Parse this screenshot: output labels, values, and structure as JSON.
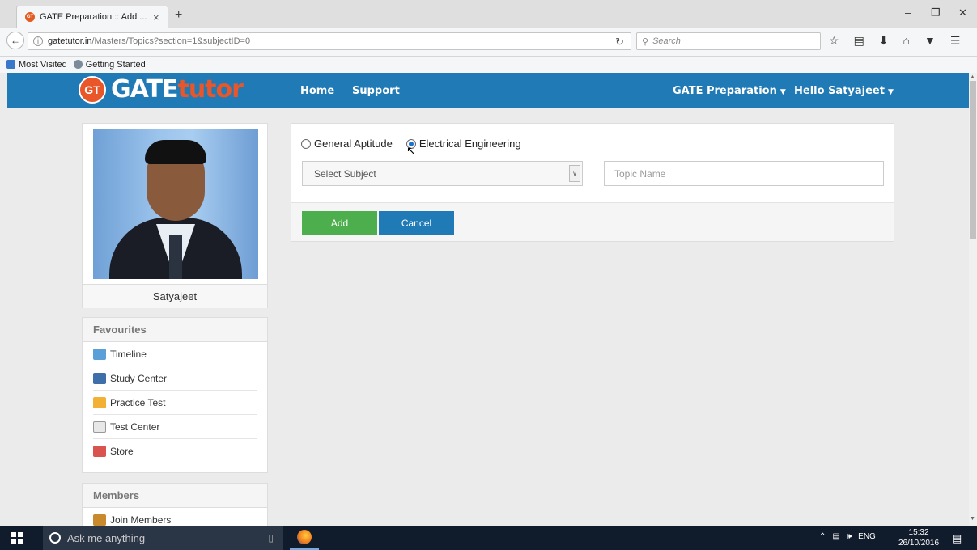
{
  "browser": {
    "tab_title": "GATE Preparation :: Add ...",
    "tab_close": "×",
    "new_tab": "+",
    "win_min": "–",
    "win_max": "❐",
    "win_close": "✕",
    "url_domain": "gatetutor.in",
    "url_path": "/Masters/Topics?section=1&subjectID=0",
    "search_placeholder": "Search",
    "bookmarks": [
      "Most Visited",
      "Getting Started"
    ]
  },
  "site": {
    "logo_badge": "GT",
    "logo_gate": "GATE",
    "logo_tutor": "tutor",
    "nav": {
      "home": "Home",
      "support": "Support",
      "prep": "GATE Preparation",
      "user": "Hello Satyajeet"
    }
  },
  "profile": {
    "name": "Satyajeet"
  },
  "favourites": {
    "heading": "Favourites",
    "items": [
      "Timeline",
      "Study Center",
      "Practice Test",
      "Test Center",
      "Store"
    ]
  },
  "members": {
    "heading": "Members",
    "items": [
      "Join Members"
    ]
  },
  "form": {
    "radio_general": "General Aptitude",
    "radio_electrical": "Electrical Engineering",
    "selected_radio": "Electrical Engineering",
    "subject_select": "Select Subject",
    "topic_placeholder": "Topic Name",
    "add_label": "Add",
    "cancel_label": "Cancel"
  },
  "taskbar": {
    "cortana_placeholder": "Ask me anything",
    "lang": "ENG",
    "time": "15:32",
    "date": "26/10/2016"
  },
  "colors": {
    "brand": "#1f7ab5",
    "accent": "#e8562a",
    "success": "#4cae4c"
  }
}
